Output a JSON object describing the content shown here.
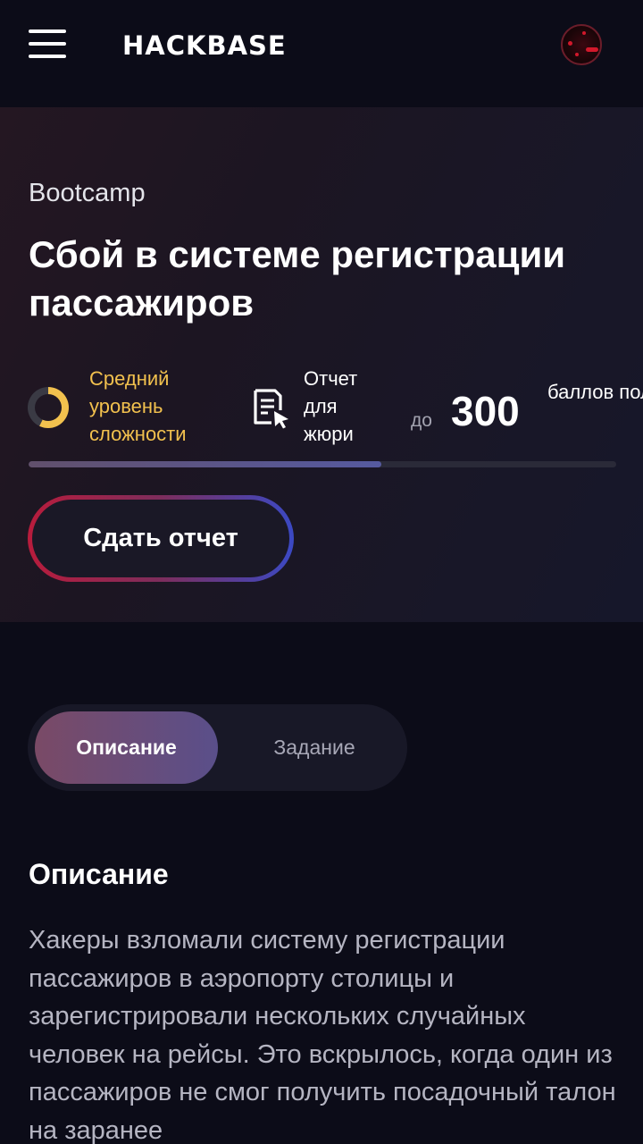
{
  "header": {
    "logo": "HACKBASE",
    "menu_icon": "hamburger-menu-icon",
    "avatar_icon": "user-avatar"
  },
  "task": {
    "track": "Bootcamp",
    "title": "Сбой в системе регистрации пассажиров",
    "difficulty": {
      "icon": "difficulty-ring-icon",
      "label": "Средний уровень сложности",
      "color": "#f2c14e",
      "level_fraction": 0.57
    },
    "report": {
      "icon": "document-cursor-icon",
      "label": "Отчет для жюри"
    },
    "points": {
      "prefix": "до",
      "value": "300",
      "label": "баллов получи"
    },
    "progress_fraction": 0.6,
    "submit_label": "Сдать отчет"
  },
  "tabs": [
    {
      "label": "Описание",
      "active": true
    },
    {
      "label": "Задание",
      "active": false
    }
  ],
  "description": {
    "heading": "Описание",
    "text": "Хакеры взломали систему регистрации пассажиров в аэропорту столицы и зарегистрировали нескольких случайных человек на рейсы. Это вскрылось, когда один из пассажиров не смог получить посадочный талон на заранее"
  },
  "colors": {
    "background": "#0c0c18",
    "accent_red": "#b81c3c",
    "accent_blue": "#3b49c4",
    "accent_yellow": "#f2c14e"
  }
}
